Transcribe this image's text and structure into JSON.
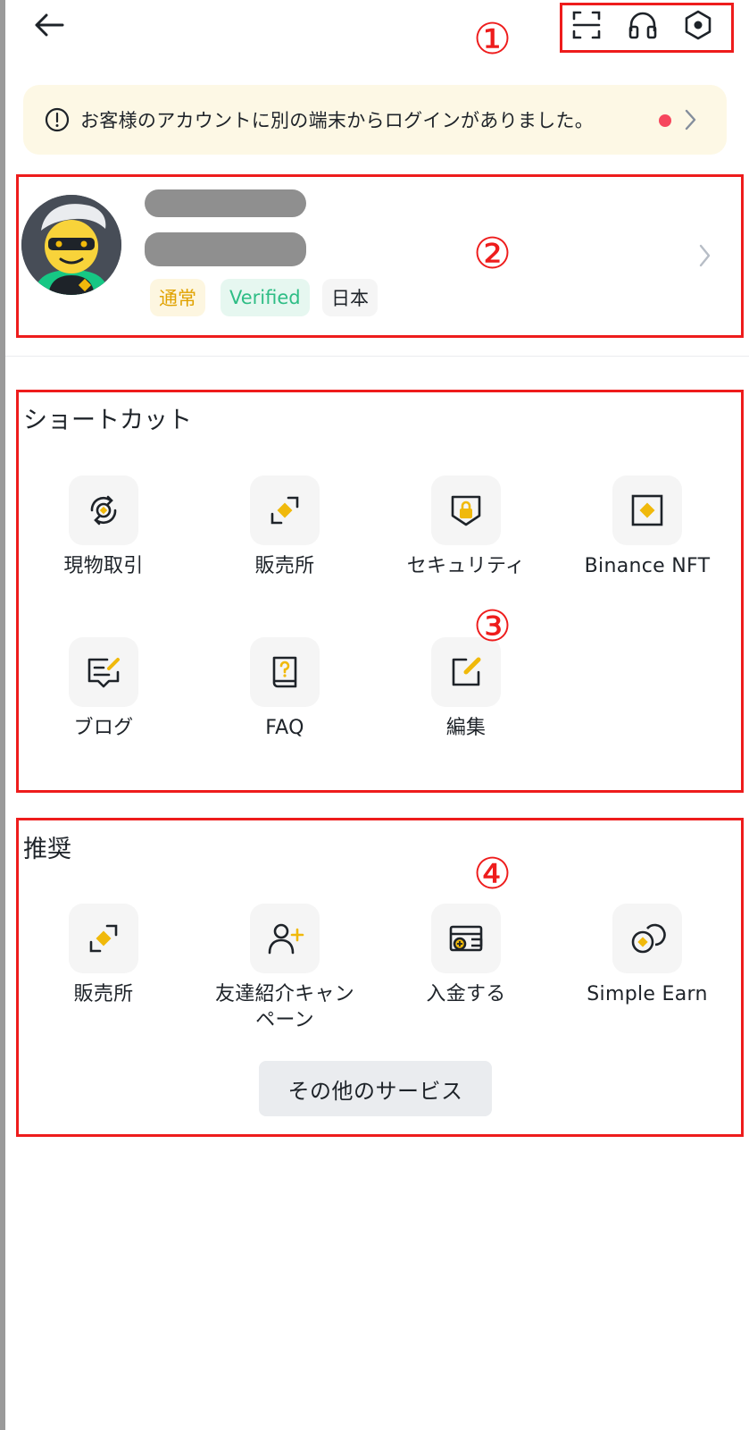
{
  "header": {
    "back_icon": "arrow-left-icon",
    "actions": [
      {
        "icon": "scan-icon"
      },
      {
        "icon": "headset-support-icon"
      },
      {
        "icon": "settings-hexagon-icon"
      }
    ]
  },
  "annotations": {
    "marker_1": "①",
    "marker_2": "②",
    "marker_3": "③",
    "marker_4": "④",
    "box_color": "#ee1c1c"
  },
  "notice": {
    "icon": "alert-circle-icon",
    "text": "お客様のアカウントに別の端末からログインがありました。",
    "unread_dot_color": "#f6465d"
  },
  "profile": {
    "avatar": "avatar-bitcoin-sunglasses",
    "badges": [
      {
        "label": "通常",
        "bg": "#fdf6e0",
        "color": "#e0a200"
      },
      {
        "label": "Verified",
        "bg": "#e6f7f0",
        "color": "#2ebd85"
      },
      {
        "label": "日本",
        "bg": "#f5f5f5",
        "color": "#1e2329"
      }
    ]
  },
  "shortcuts": {
    "title": "ショートカット",
    "items": [
      {
        "label": "現物取引",
        "icon": "spot-trade-icon"
      },
      {
        "label": "販売所",
        "icon": "convert-icon"
      },
      {
        "label": "セキュリティ",
        "icon": "security-shield-icon"
      },
      {
        "label": "Binance NFT",
        "icon": "nft-icon"
      },
      {
        "label": "ブログ",
        "icon": "blog-icon"
      },
      {
        "label": "FAQ",
        "icon": "faq-book-icon"
      },
      {
        "label": "編集",
        "icon": "edit-icon"
      }
    ]
  },
  "recommended": {
    "title": "推奨",
    "items": [
      {
        "label": "販売所",
        "icon": "convert-icon"
      },
      {
        "label": "友達紹介キャンペーン",
        "icon": "referral-icon"
      },
      {
        "label": "入金する",
        "icon": "deposit-icon"
      },
      {
        "label": "Simple Earn",
        "icon": "simple-earn-icon"
      }
    ],
    "more_button": "その他のサービス"
  },
  "colors": {
    "accent": "#f0b90b",
    "text": "#1e2329"
  }
}
